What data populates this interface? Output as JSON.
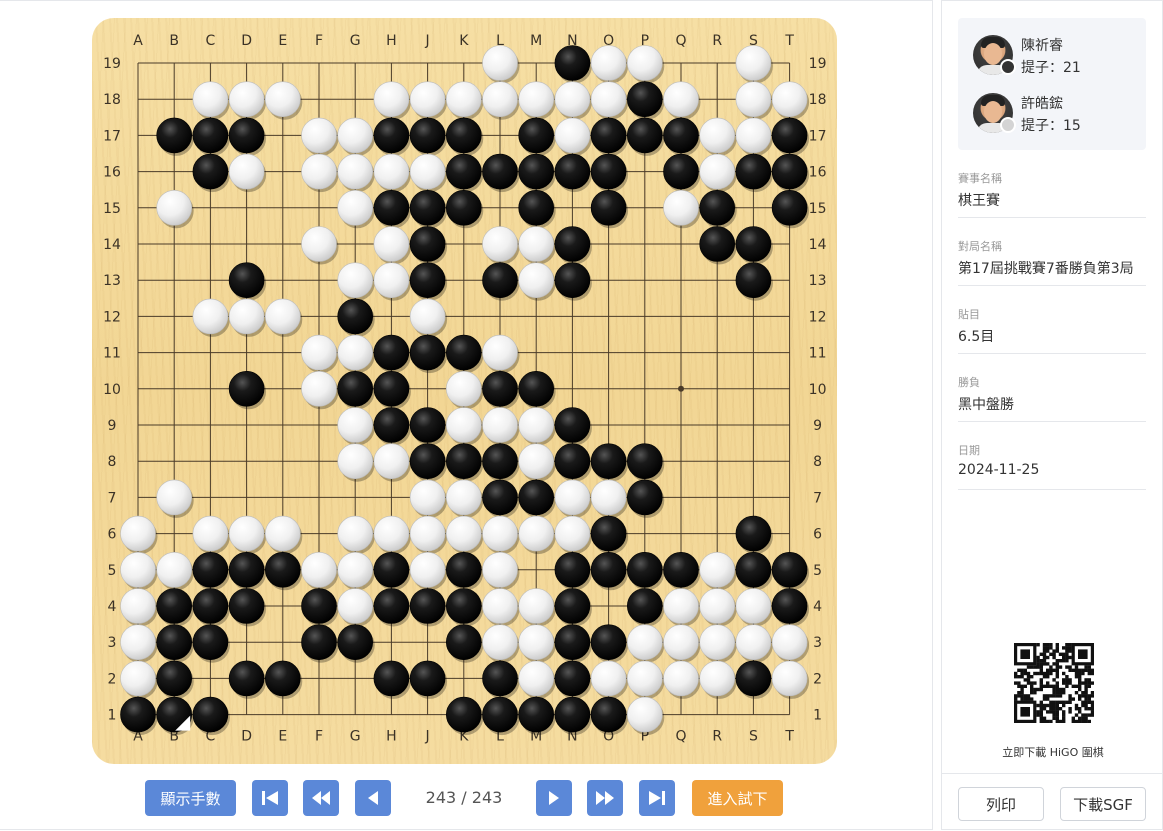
{
  "board": {
    "size": 19,
    "columns": [
      "A",
      "B",
      "C",
      "D",
      "E",
      "F",
      "G",
      "H",
      "J",
      "K",
      "L",
      "M",
      "N",
      "O",
      "P",
      "Q",
      "R",
      "S",
      "T"
    ],
    "rows": [
      "19",
      "18",
      "17",
      "16",
      "15",
      "14",
      "13",
      "12",
      "11",
      "10",
      "9",
      "8",
      "7",
      "6",
      "5",
      "4",
      "3",
      "2",
      "1"
    ],
    "position": [
      "..........W.BWW..W.",
      "..WWW..WWWWWWWBW.WW",
      ".BBB.WWBBB.BWBBBWWB",
      "..BW.WWWWBBBBB.BWBB",
      ".W....WBBB.B.B.WB.B",
      ".....W.WB.WWB...BB.",
      "...B..WWB.BWB....B.",
      "..WWW.B.W..........",
      ".....WWBBBW........",
      "...B.WBB.WBB.......",
      "......WBBWWWB......",
      "......WWBBBWBBB....",
      ".W......WWBBWWB....",
      "W.WWW.WWWWWWWB...B.",
      "WWBBBWWBWBW.BBBBWBB",
      "WBBB.BWBBBWWB.BWWWB",
      "WBB..BB..BWWBBWWWWW",
      "WB.BB..BB.BWBWWWWBW",
      "BBB......BBBBBW...."
    ],
    "last_move": "B1",
    "star_points": [
      "D16",
      "K16",
      "Q16",
      "D10",
      "K10",
      "Q10",
      "D4",
      "K4",
      "Q4"
    ]
  },
  "controls": {
    "show_moves_label": "顯示手數",
    "first_icon": "skip-to-start-icon",
    "back10_icon": "fast-rewind-icon",
    "back1_icon": "step-back-icon",
    "move_counter": "243 / 243",
    "forward1_icon": "step-forward-icon",
    "forward10_icon": "fast-forward-icon",
    "last_icon": "skip-to-end-icon",
    "try_label": "進入試下"
  },
  "players": [
    {
      "name": "陳祈睿",
      "captures": "提子：21",
      "color": "black"
    },
    {
      "name": "許皓鋐",
      "captures": "提子：15",
      "color": "white"
    }
  ],
  "info": [
    {
      "label": "賽事名稱",
      "value": "棋王賽"
    },
    {
      "label": "對局名稱",
      "value": "第17屆挑戰賽7番勝負第3局"
    },
    {
      "label": "貼目",
      "value": "6.5目"
    },
    {
      "label": "勝負",
      "value": "黑中盤勝"
    },
    {
      "label": "日期",
      "value": "2024-11-25"
    }
  ],
  "qr_caption": "立即下載 HiGO 圍棋",
  "buttons": {
    "print": "列印",
    "download": "下載SGF"
  },
  "colors": {
    "board": "#f3d898",
    "button_blue": "#5b88d8",
    "button_orange": "#f0a13c",
    "panel_bg": "#f3f5f9"
  }
}
